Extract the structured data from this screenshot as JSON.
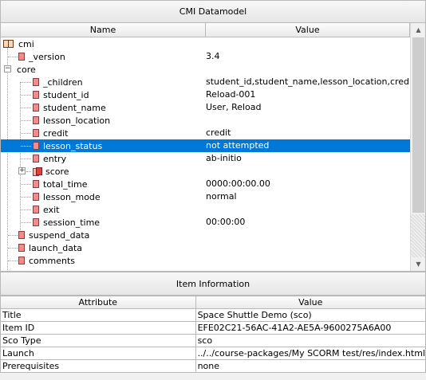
{
  "datamodel": {
    "title": "CMI Datamodel",
    "columns": {
      "name": "Name",
      "value": "Value"
    },
    "rows": [
      {
        "name": "cmi",
        "value": ""
      },
      {
        "name": "_version",
        "value": "3.4"
      },
      {
        "name": "core",
        "value": ""
      },
      {
        "name": "_children",
        "value": "student_id,student_name,lesson_location,credit,l..."
      },
      {
        "name": "student_id",
        "value": "Reload-001"
      },
      {
        "name": "student_name",
        "value": "User, Reload"
      },
      {
        "name": "lesson_location",
        "value": ""
      },
      {
        "name": "credit",
        "value": "credit"
      },
      {
        "name": "lesson_status",
        "value": "not attempted"
      },
      {
        "name": "entry",
        "value": "ab-initio"
      },
      {
        "name": "score",
        "value": ""
      },
      {
        "name": "total_time",
        "value": "0000:00:00.00"
      },
      {
        "name": "lesson_mode",
        "value": "normal"
      },
      {
        "name": "exit",
        "value": ""
      },
      {
        "name": "session_time",
        "value": "00:00:00"
      },
      {
        "name": "suspend_data",
        "value": ""
      },
      {
        "name": "launch_data",
        "value": ""
      },
      {
        "name": "comments",
        "value": ""
      }
    ],
    "selected_row": "lesson_status",
    "expander_minus": "−",
    "expander_plus": "+"
  },
  "item_info": {
    "title": "Item Information",
    "columns": {
      "attribute": "Attribute",
      "value": "Value"
    },
    "rows": [
      {
        "attribute": "Title",
        "value": "Space Shuttle Demo (sco)"
      },
      {
        "attribute": "Item ID",
        "value": "EFE02C21-56AC-41A2-AE5A-9600275A6A00"
      },
      {
        "attribute": "Sco Type",
        "value": "sco"
      },
      {
        "attribute": "Launch",
        "value": "../../course-packages/My SCORM test/res/index.html"
      },
      {
        "attribute": "Prerequisites",
        "value": "none"
      }
    ]
  },
  "scrollbar": {
    "up_arrow": "▲",
    "down_arrow": "▼"
  },
  "colors": {
    "selection": "#0078d7",
    "leaf_icon": "#f08c8c"
  }
}
